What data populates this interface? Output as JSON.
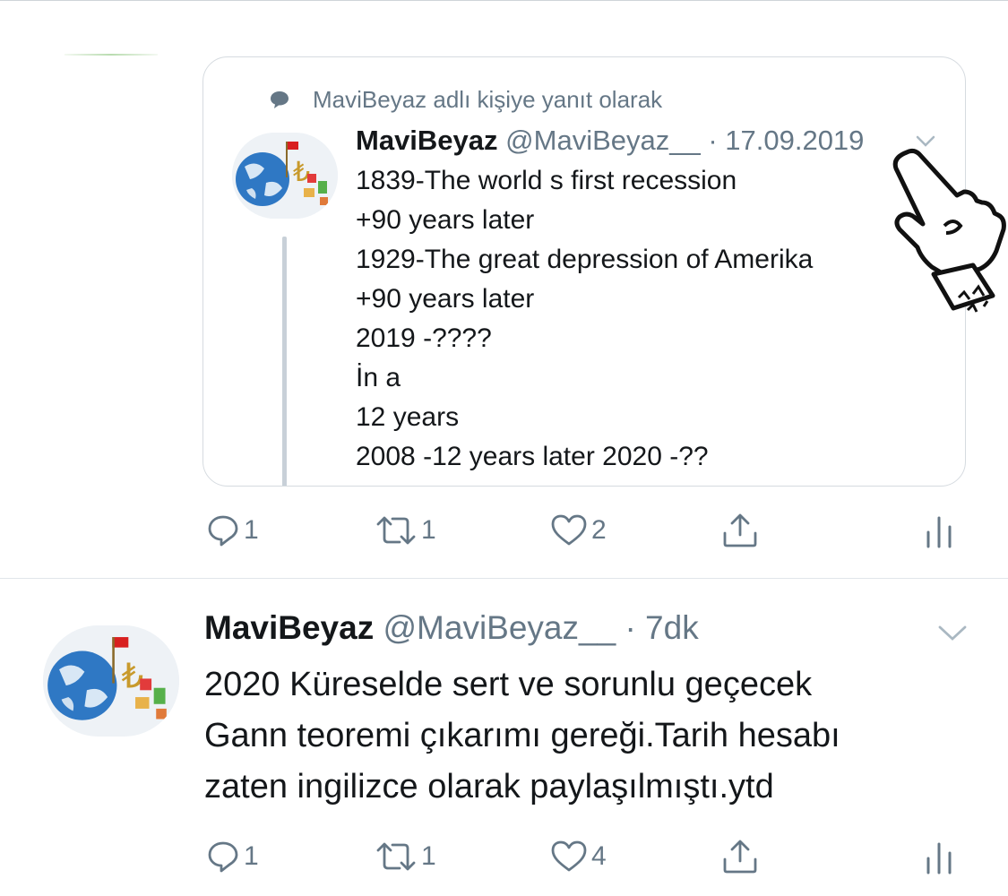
{
  "colors": {
    "text": "#14171a",
    "secondary": "#657786",
    "border": "#d6dbe0",
    "thread": "#c8d0d8"
  },
  "quoted_tweet": {
    "reply_context": "MaviBeyaz adlı kişiye yanıt olarak",
    "author_name": "MaviBeyaz",
    "handle_date": "@MaviBeyaz__ · 17.09.2019",
    "avatar_icon": "globe-lira-avatar",
    "lines": [
      "1839-The world s first recession",
      "+90 years later",
      "1929-The great depression of Amerika",
      "+90 years later",
      "2019 -????",
      "İn a",
      "12 years",
      "2008 -12 years later 2020 -??"
    ],
    "actions": {
      "replies": "1",
      "retweets": "1",
      "likes": "2"
    }
  },
  "main_tweet": {
    "author_name": "MaviBeyaz",
    "handle_time": "@MaviBeyaz__ · 7dk",
    "avatar_icon": "globe-lira-avatar",
    "lines": [
      "2020 Küreselde sert ve sorunlu geçecek",
      "Gann teoremi çıkarımı gereği.Tarih hesabı",
      "zaten ingilizce olarak paylaşılmıştı.ytd"
    ],
    "actions": {
      "replies": "1",
      "retweets": "1",
      "likes": "4"
    }
  }
}
